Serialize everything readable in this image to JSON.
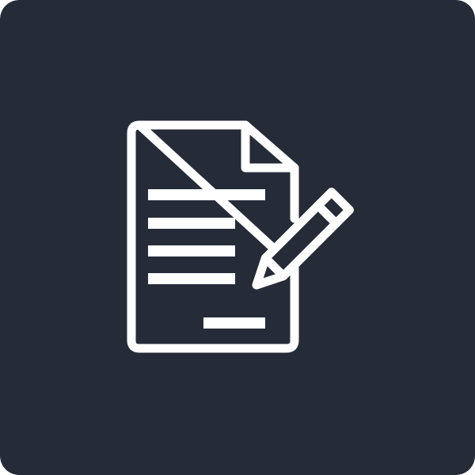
{
  "icon": {
    "name": "document-edit-icon",
    "background_color": "#262b38",
    "stroke_color": "#ffffff"
  }
}
